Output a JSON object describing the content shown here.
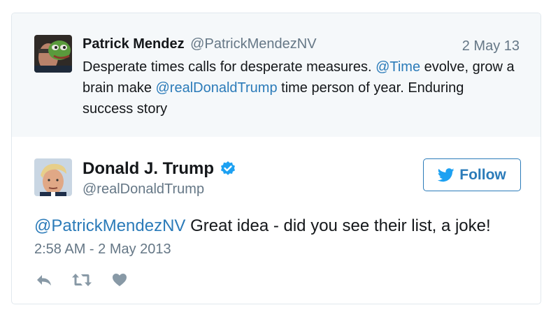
{
  "parent_tweet": {
    "name": "Patrick Mendez",
    "handle": "@PatrickMendezNV",
    "date": "2 May 13",
    "text_part1": "Desperate times calls for desperate measures. ",
    "mention_time": "@Time",
    "text_part2": " evolve, grow a brain make ",
    "mention_trump": "@realDonaldTrump",
    "text_part3": " time person of year. Enduring success story"
  },
  "tweet": {
    "name": "Donald J. Trump",
    "handle": "@realDonaldTrump",
    "follow_label": "Follow",
    "mention": "@PatrickMendezNV",
    "text": " Great idea - did you see their list, a joke!",
    "timestamp": "2:58 AM - 2 May 2013"
  },
  "colors": {
    "link": "#2b7bb9",
    "muted": "#657786",
    "verified": "#1da1f2",
    "parent_background": "#f5f8fa"
  },
  "icons": [
    "verified-badge-icon",
    "twitter-bird-icon",
    "reply-icon",
    "retweet-icon",
    "heart-icon"
  ]
}
